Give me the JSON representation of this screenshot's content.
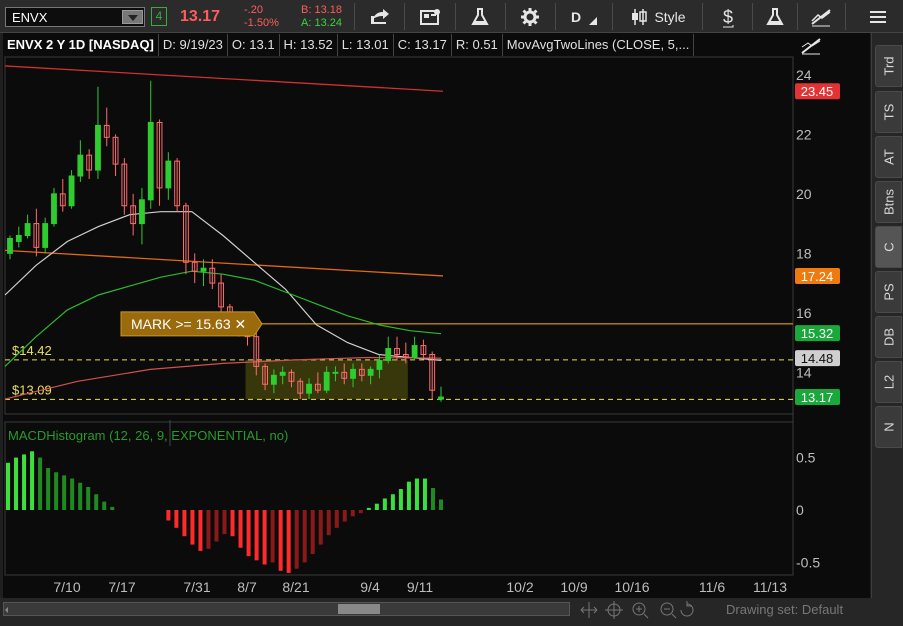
{
  "toolbar": {
    "symbol": "ENVX",
    "link_badge": "4",
    "last_price": "13.17",
    "change": "-.20",
    "change_pct": "-1.50%",
    "bid": "B: 13.18",
    "ask": "A: 13.24",
    "d_label": "D",
    "style_label": "Style",
    "colors": {
      "down": "#ff5c5c",
      "bid": "#ff5c5c",
      "ask": "#3cd33c"
    }
  },
  "chart_header": {
    "title": "ENVX 2 Y 1D [NASDAQ]",
    "date": "D: 9/19/23",
    "open": "O: 13.1",
    "high": "H: 13.52",
    "low": "L: 13.01",
    "close": "C: 13.17",
    "range": "R: 0.51",
    "study": "MovAvgTwoLines (CLOSE, 5,..."
  },
  "price_axis": {
    "ticks": [
      "24",
      "22",
      "20",
      "18",
      "16",
      "14"
    ],
    "badges": [
      {
        "label": "23.45",
        "color": "#e23434"
      },
      {
        "label": "17.24",
        "color": "#ef7a10"
      },
      {
        "label": "15.32",
        "color": "#1aa83c"
      },
      {
        "label": "14.48",
        "color": "#cfcfcf"
      },
      {
        "label": "13.17",
        "color": "#1aa83c"
      }
    ]
  },
  "price_lines": {
    "line_1_label": "$14.42",
    "line_2_label": "$13.09"
  },
  "alert": {
    "text": "MARK >= 15.63 ✕"
  },
  "lower_study": {
    "title": "MACDHistogram (12, 26, 9, EXPONENTIAL, no)",
    "ticks": [
      "0.5",
      "0",
      "-0.5"
    ]
  },
  "time_axis": [
    "7/10",
    "7/17",
    "7/31",
    "8/7",
    "8/21",
    "9/4",
    "9/11",
    "10/2",
    "10/9",
    "10/16",
    "11/6",
    "11/13"
  ],
  "right_tabs": [
    "Trd",
    "TS",
    "AT",
    "Btns",
    "C",
    "PS",
    "DB",
    "L2",
    "N"
  ],
  "footer": {
    "drawing_set": "Drawing set: Default"
  },
  "chart_data": [
    {
      "type": "candlestick",
      "title": "ENVX 2 Y 1D [NASDAQ]",
      "ylim": [
        12.6,
        24.6
      ],
      "ohlc": [
        [
          18.0,
          18.6,
          17.8,
          18.5
        ],
        [
          18.4,
          18.9,
          18.2,
          18.6
        ],
        [
          18.6,
          19.3,
          18.5,
          19.0
        ],
        [
          19.0,
          19.5,
          17.9,
          18.2
        ],
        [
          18.2,
          19.2,
          18.0,
          19.0
        ],
        [
          19.0,
          20.2,
          18.9,
          20.0
        ],
        [
          20.0,
          20.5,
          19.4,
          19.6
        ],
        [
          19.6,
          20.8,
          19.5,
          20.6
        ],
        [
          20.6,
          21.8,
          20.4,
          21.3
        ],
        [
          21.3,
          21.5,
          20.5,
          20.8
        ],
        [
          20.8,
          23.6,
          20.5,
          22.3
        ],
        [
          22.3,
          22.9,
          21.6,
          21.9
        ],
        [
          21.9,
          22.0,
          20.6,
          21.0
        ],
        [
          21.0,
          21.2,
          19.3,
          19.6
        ],
        [
          19.6,
          20.0,
          18.6,
          19.0
        ],
        [
          19.0,
          20.2,
          18.3,
          19.8
        ],
        [
          19.8,
          23.8,
          19.5,
          22.4
        ],
        [
          22.4,
          22.5,
          19.6,
          20.2
        ],
        [
          20.2,
          21.4,
          19.8,
          21.1
        ],
        [
          21.1,
          21.2,
          19.4,
          19.6
        ],
        [
          19.6,
          19.7,
          17.3,
          17.7
        ],
        [
          17.7,
          18.0,
          17.0,
          17.4
        ],
        [
          17.4,
          17.8,
          16.9,
          17.5
        ],
        [
          17.5,
          17.8,
          16.8,
          17.0
        ],
        [
          17.0,
          17.3,
          16.0,
          16.2
        ],
        [
          16.2,
          16.3,
          15.4,
          15.6
        ],
        [
          15.6,
          16.0,
          15.2,
          15.8
        ],
        [
          15.8,
          16.0,
          14.9,
          15.2
        ],
        [
          15.2,
          15.4,
          13.9,
          14.2
        ],
        [
          14.2,
          14.3,
          13.4,
          13.6
        ],
        [
          13.6,
          14.1,
          13.3,
          13.9
        ],
        [
          13.9,
          14.2,
          13.6,
          14.0
        ],
        [
          14.0,
          14.1,
          13.5,
          13.7
        ],
        [
          13.7,
          13.8,
          13.1,
          13.3
        ],
        [
          13.3,
          13.8,
          13.1,
          13.6
        ],
        [
          13.6,
          14.0,
          13.3,
          13.4
        ],
        [
          13.4,
          14.2,
          13.3,
          14.0
        ],
        [
          14.0,
          14.2,
          13.7,
          14.0
        ],
        [
          14.0,
          14.3,
          13.6,
          13.8
        ],
        [
          13.8,
          14.3,
          13.5,
          14.1
        ],
        [
          14.1,
          14.3,
          13.7,
          13.9
        ],
        [
          13.9,
          14.2,
          13.6,
          14.1
        ],
        [
          14.1,
          14.6,
          13.8,
          14.4
        ],
        [
          14.4,
          15.2,
          14.3,
          14.8
        ],
        [
          14.8,
          15.2,
          14.4,
          14.6
        ],
        [
          14.6,
          15.0,
          14.3,
          14.5
        ],
        [
          14.5,
          15.2,
          14.4,
          14.9
        ],
        [
          14.9,
          15.1,
          14.5,
          14.6
        ],
        [
          14.6,
          14.7,
          13.1,
          13.4
        ],
        [
          13.1,
          13.52,
          13.01,
          13.17
        ]
      ],
      "moving_averages": [
        {
          "name": "MA short",
          "color": "#cfcfcf",
          "values": [
            16.6,
            17.6,
            18.4,
            18.9,
            19.3,
            19.4,
            19.4,
            18.6,
            17.7,
            16.8,
            15.6,
            15.0,
            14.6,
            14.5,
            14.4
          ]
        },
        {
          "name": "MA long",
          "color": "#2db82d",
          "values": [
            14.2,
            15.2,
            16.1,
            16.6,
            16.9,
            17.2,
            17.4,
            17.3,
            17.1,
            16.7,
            16.3,
            15.9,
            15.6,
            15.4,
            15.3
          ]
        },
        {
          "name": "MA red",
          "color": "#d05050",
          "values": [
            13.1,
            13.7,
            14.1,
            14.3,
            14.42,
            14.5,
            14.48
          ]
        }
      ],
      "trendlines": [
        {
          "color": "#d03030",
          "from": 24.3,
          "to": 23.45
        },
        {
          "color": "#e06a10",
          "from": 18.1,
          "to": 17.24
        }
      ],
      "horizontal_lines": [
        {
          "label": "$14.42",
          "value": 14.42,
          "color": "#e8e060",
          "style": "dashed"
        },
        {
          "label": "$13.09",
          "value": 13.09,
          "color": "#e8e060",
          "style": "dashed"
        },
        {
          "label": "MARK >= 15.63",
          "value": 15.63,
          "color": "#b8860b",
          "style": "solid"
        }
      ]
    },
    {
      "type": "bar",
      "title": "MACDHistogram (12, 26, 9, EXPONENTIAL, no)",
      "ylim": [
        -0.62,
        0.62
      ],
      "values": [
        0.45,
        0.5,
        0.53,
        0.56,
        0.5,
        0.4,
        0.36,
        0.33,
        0.3,
        0.26,
        0.22,
        0.15,
        0.08,
        0.03,
        0.0,
        0.0,
        0.0,
        0.0,
        0.0,
        0.0,
        -0.1,
        -0.17,
        -0.25,
        -0.33,
        -0.39,
        -0.37,
        -0.3,
        -0.23,
        -0.25,
        -0.36,
        -0.44,
        -0.48,
        -0.52,
        -0.5,
        -0.58,
        -0.6,
        -0.56,
        -0.5,
        -0.42,
        -0.33,
        -0.24,
        -0.17,
        -0.11,
        -0.06,
        -0.03,
        0.02,
        0.06,
        0.11,
        0.15,
        0.2,
        0.27,
        0.3,
        0.3,
        0.21,
        0.1
      ]
    }
  ]
}
